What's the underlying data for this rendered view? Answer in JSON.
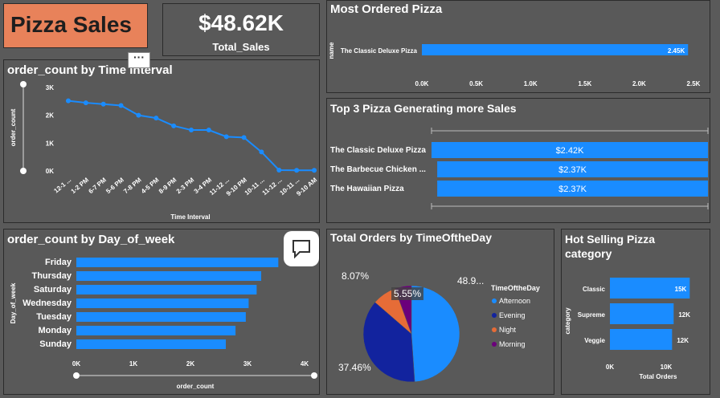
{
  "header": {
    "title": "Pizza Sales"
  },
  "kpi": {
    "value": "$48.62K",
    "label": "Total_Sales"
  },
  "colors": {
    "accent": "#1a8cff",
    "panel_bg": "#595959",
    "title_bg": "#e8825a",
    "dark_blue": "#12239e",
    "orange": "#e66c37",
    "purple": "#6b007b"
  },
  "icons": {
    "more": "more-options-icon",
    "comment": "comment-icon"
  },
  "chart_data": [
    {
      "id": "time_interval",
      "type": "line",
      "title": "order_count by Time Interval",
      "xlabel": "Time Interval",
      "ylabel": "order_count",
      "ylim": [
        0,
        3000
      ],
      "yticks": [
        "3K",
        "2K",
        "1K",
        "0K"
      ],
      "categories": [
        "12-1 ...",
        "1-2 PM",
        "6-7 PM",
        "5-6 PM",
        "7-8 PM",
        "4-5 PM",
        "8-9 PM",
        "2-3 PM",
        "3-4 PM",
        "11-12 ...",
        "9-10 PM",
        "10-11 ...",
        "11-12 ...",
        "10-11 ...",
        "9-10 AM"
      ],
      "values": [
        2520,
        2450,
        2400,
        2350,
        2000,
        1900,
        1620,
        1470,
        1470,
        1230,
        1200,
        680,
        30,
        20,
        20
      ]
    },
    {
      "id": "day_of_week",
      "type": "bar",
      "orientation": "horizontal",
      "title": "order_count by Day_of_week",
      "xlabel": "order_count",
      "ylabel": "Day_of_week",
      "xlim": [
        0,
        4000
      ],
      "xticks": [
        "0K",
        "1K",
        "2K",
        "3K",
        "4K"
      ],
      "categories": [
        "Friday",
        "Thursday",
        "Saturday",
        "Wednesday",
        "Tuesday",
        "Monday",
        "Sunday"
      ],
      "values": [
        3540,
        3240,
        3160,
        3020,
        2970,
        2790,
        2620
      ]
    },
    {
      "id": "most_ordered",
      "type": "bar",
      "orientation": "horizontal",
      "title": "Most Ordered Pizza",
      "ylabel": "name",
      "xlim": [
        0,
        2500
      ],
      "xticks": [
        "0.0K",
        "0.5K",
        "1.0K",
        "1.5K",
        "2.0K",
        "2.5K"
      ],
      "categories": [
        "The Classic Deluxe Pizza"
      ],
      "values": [
        2450
      ],
      "data_labels": [
        "2.45K"
      ]
    },
    {
      "id": "top3",
      "type": "bar",
      "orientation": "horizontal",
      "title": "Top 3 Pizza Generating more Sales",
      "categories": [
        "The Classic Deluxe Pizza",
        "The Barbecue Chicken ...",
        "The Hawaiian Pizza"
      ],
      "values": [
        2420,
        2370,
        2370
      ],
      "data_labels": [
        "$2.42K",
        "$2.37K",
        "$2.37K"
      ]
    },
    {
      "id": "time_of_day",
      "type": "pie",
      "title": "Total Orders by TimeOftheDay",
      "legend_title": "TimeOftheDay",
      "legend_placement": "right",
      "categories": [
        "Afternoon",
        "Evening",
        "Night",
        "Morning"
      ],
      "values": [
        48.92,
        37.46,
        8.07,
        5.55
      ],
      "data_labels": [
        "48.9...",
        "37.46%",
        "8.07%",
        "5.55%"
      ]
    },
    {
      "id": "category",
      "type": "bar",
      "orientation": "horizontal",
      "title": "Hot Selling Pizza category",
      "title_lines": [
        "Hot Selling Pizza",
        "category"
      ],
      "xlabel": "Total Orders",
      "ylabel": "category",
      "xlim": [
        0,
        15000
      ],
      "xticks": [
        "0K",
        "10K"
      ],
      "categories": [
        "Classic",
        "Supreme",
        "Veggie"
      ],
      "values": [
        14900,
        11900,
        11600
      ],
      "data_labels": [
        "15K",
        "12K",
        "12K"
      ]
    }
  ]
}
